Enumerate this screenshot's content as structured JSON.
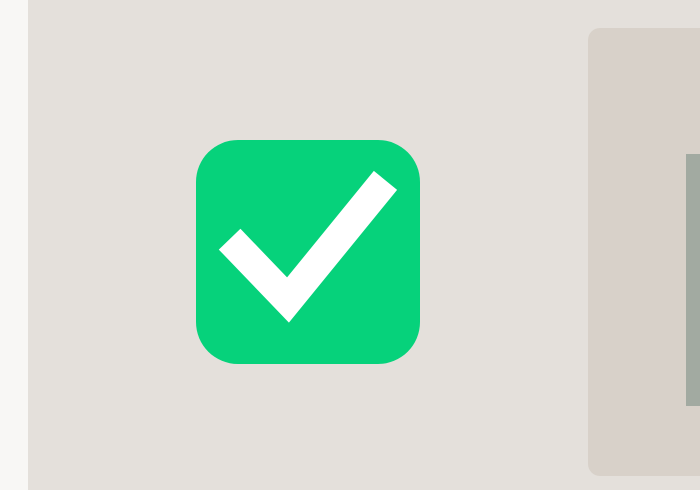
{
  "status": {
    "icon": "check-icon",
    "state": "success"
  },
  "colors": {
    "background": "#e4e0db",
    "left_strip": "#f8f7f5",
    "badge": "#06d27b",
    "checkmark": "#ffffff",
    "side_panel": "#d8d1c9",
    "side_panel_accent": "#a2aaa1"
  }
}
